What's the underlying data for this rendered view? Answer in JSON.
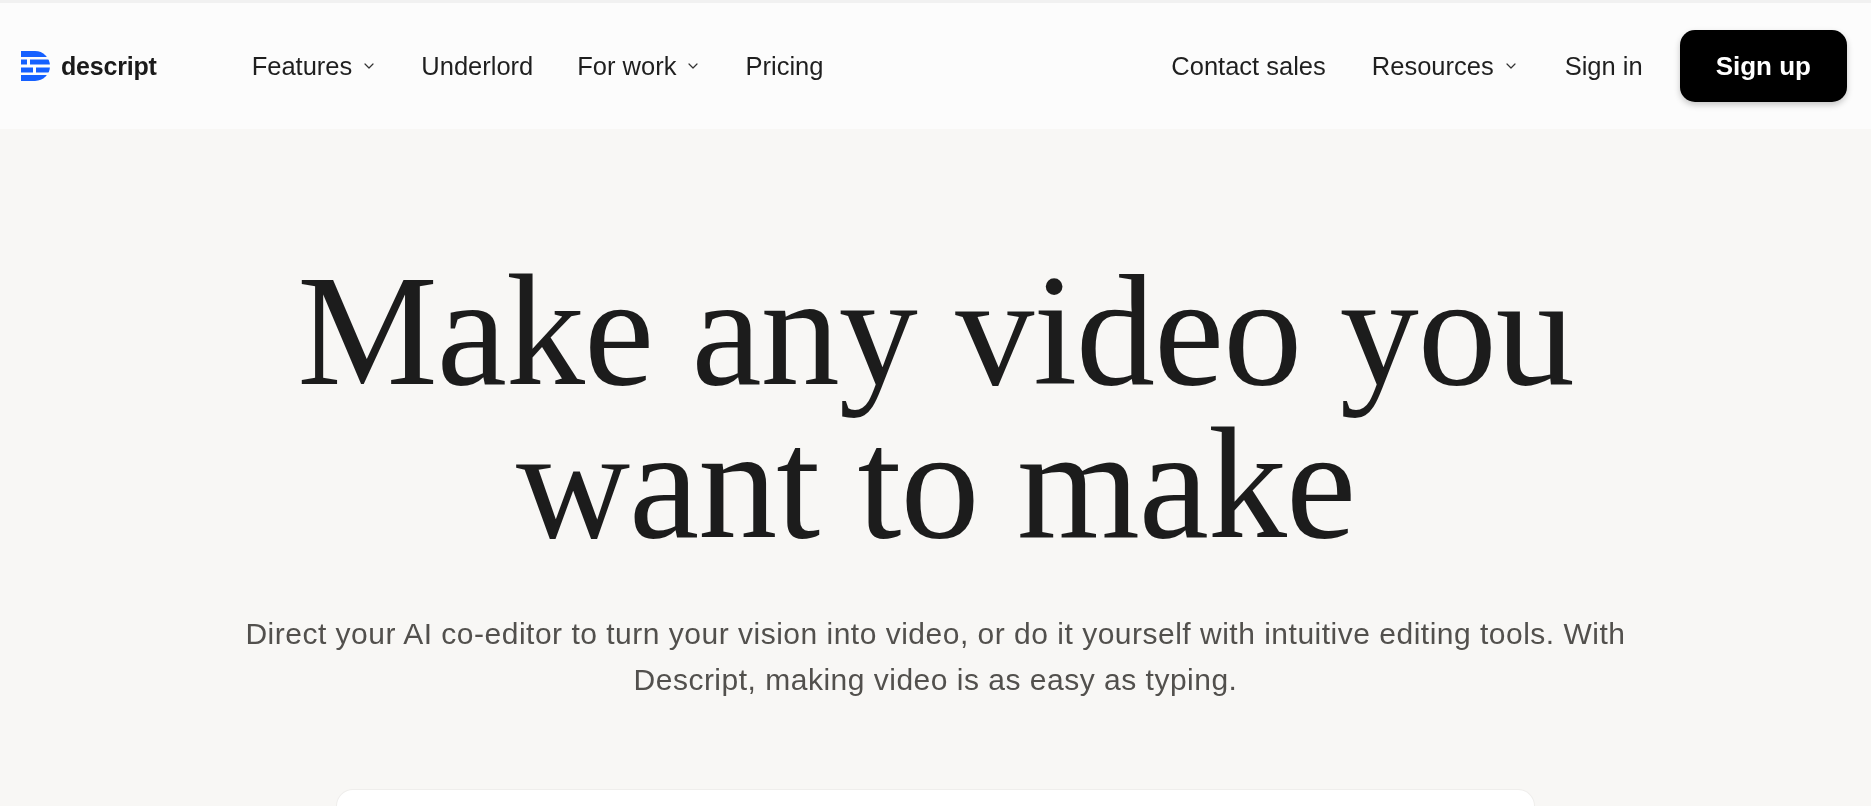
{
  "logo": {
    "text": "descript"
  },
  "nav": {
    "left": [
      {
        "label": "Features",
        "dropdown": true
      },
      {
        "label": "Underlord",
        "dropdown": false
      },
      {
        "label": "For work",
        "dropdown": true
      },
      {
        "label": "Pricing",
        "dropdown": false
      }
    ],
    "right": [
      {
        "label": "Contact sales",
        "dropdown": false
      },
      {
        "label": "Resources",
        "dropdown": true
      },
      {
        "label": "Sign in",
        "dropdown": false
      }
    ],
    "cta": {
      "label": "Sign up"
    }
  },
  "hero": {
    "headline": "Make any video you want to make",
    "subtitle": "Direct your AI co-editor to turn your vision into video, or do it yourself with intuitive editing tools. With Descript, making video is as easy as typing."
  }
}
